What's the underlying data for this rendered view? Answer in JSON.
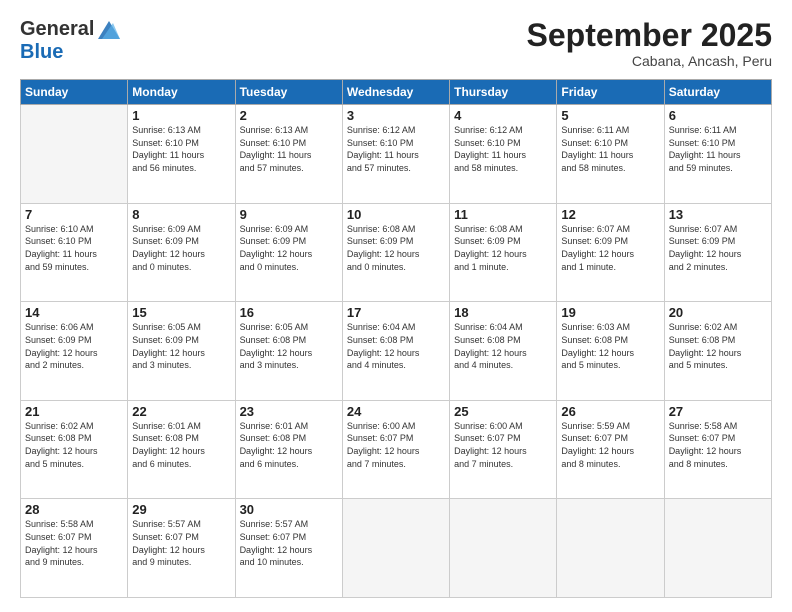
{
  "header": {
    "logo_general": "General",
    "logo_blue": "Blue",
    "month_title": "September 2025",
    "location": "Cabana, Ancash, Peru"
  },
  "weekdays": [
    "Sunday",
    "Monday",
    "Tuesday",
    "Wednesday",
    "Thursday",
    "Friday",
    "Saturday"
  ],
  "weeks": [
    [
      {
        "day": "",
        "info": ""
      },
      {
        "day": "1",
        "info": "Sunrise: 6:13 AM\nSunset: 6:10 PM\nDaylight: 11 hours\nand 56 minutes."
      },
      {
        "day": "2",
        "info": "Sunrise: 6:13 AM\nSunset: 6:10 PM\nDaylight: 11 hours\nand 57 minutes."
      },
      {
        "day": "3",
        "info": "Sunrise: 6:12 AM\nSunset: 6:10 PM\nDaylight: 11 hours\nand 57 minutes."
      },
      {
        "day": "4",
        "info": "Sunrise: 6:12 AM\nSunset: 6:10 PM\nDaylight: 11 hours\nand 58 minutes."
      },
      {
        "day": "5",
        "info": "Sunrise: 6:11 AM\nSunset: 6:10 PM\nDaylight: 11 hours\nand 58 minutes."
      },
      {
        "day": "6",
        "info": "Sunrise: 6:11 AM\nSunset: 6:10 PM\nDaylight: 11 hours\nand 59 minutes."
      }
    ],
    [
      {
        "day": "7",
        "info": "Sunrise: 6:10 AM\nSunset: 6:10 PM\nDaylight: 11 hours\nand 59 minutes."
      },
      {
        "day": "8",
        "info": "Sunrise: 6:09 AM\nSunset: 6:09 PM\nDaylight: 12 hours\nand 0 minutes."
      },
      {
        "day": "9",
        "info": "Sunrise: 6:09 AM\nSunset: 6:09 PM\nDaylight: 12 hours\nand 0 minutes."
      },
      {
        "day": "10",
        "info": "Sunrise: 6:08 AM\nSunset: 6:09 PM\nDaylight: 12 hours\nand 0 minutes."
      },
      {
        "day": "11",
        "info": "Sunrise: 6:08 AM\nSunset: 6:09 PM\nDaylight: 12 hours\nand 1 minute."
      },
      {
        "day": "12",
        "info": "Sunrise: 6:07 AM\nSunset: 6:09 PM\nDaylight: 12 hours\nand 1 minute."
      },
      {
        "day": "13",
        "info": "Sunrise: 6:07 AM\nSunset: 6:09 PM\nDaylight: 12 hours\nand 2 minutes."
      }
    ],
    [
      {
        "day": "14",
        "info": "Sunrise: 6:06 AM\nSunset: 6:09 PM\nDaylight: 12 hours\nand 2 minutes."
      },
      {
        "day": "15",
        "info": "Sunrise: 6:05 AM\nSunset: 6:09 PM\nDaylight: 12 hours\nand 3 minutes."
      },
      {
        "day": "16",
        "info": "Sunrise: 6:05 AM\nSunset: 6:08 PM\nDaylight: 12 hours\nand 3 minutes."
      },
      {
        "day": "17",
        "info": "Sunrise: 6:04 AM\nSunset: 6:08 PM\nDaylight: 12 hours\nand 4 minutes."
      },
      {
        "day": "18",
        "info": "Sunrise: 6:04 AM\nSunset: 6:08 PM\nDaylight: 12 hours\nand 4 minutes."
      },
      {
        "day": "19",
        "info": "Sunrise: 6:03 AM\nSunset: 6:08 PM\nDaylight: 12 hours\nand 5 minutes."
      },
      {
        "day": "20",
        "info": "Sunrise: 6:02 AM\nSunset: 6:08 PM\nDaylight: 12 hours\nand 5 minutes."
      }
    ],
    [
      {
        "day": "21",
        "info": "Sunrise: 6:02 AM\nSunset: 6:08 PM\nDaylight: 12 hours\nand 5 minutes."
      },
      {
        "day": "22",
        "info": "Sunrise: 6:01 AM\nSunset: 6:08 PM\nDaylight: 12 hours\nand 6 minutes."
      },
      {
        "day": "23",
        "info": "Sunrise: 6:01 AM\nSunset: 6:08 PM\nDaylight: 12 hours\nand 6 minutes."
      },
      {
        "day": "24",
        "info": "Sunrise: 6:00 AM\nSunset: 6:07 PM\nDaylight: 12 hours\nand 7 minutes."
      },
      {
        "day": "25",
        "info": "Sunrise: 6:00 AM\nSunset: 6:07 PM\nDaylight: 12 hours\nand 7 minutes."
      },
      {
        "day": "26",
        "info": "Sunrise: 5:59 AM\nSunset: 6:07 PM\nDaylight: 12 hours\nand 8 minutes."
      },
      {
        "day": "27",
        "info": "Sunrise: 5:58 AM\nSunset: 6:07 PM\nDaylight: 12 hours\nand 8 minutes."
      }
    ],
    [
      {
        "day": "28",
        "info": "Sunrise: 5:58 AM\nSunset: 6:07 PM\nDaylight: 12 hours\nand 9 minutes."
      },
      {
        "day": "29",
        "info": "Sunrise: 5:57 AM\nSunset: 6:07 PM\nDaylight: 12 hours\nand 9 minutes."
      },
      {
        "day": "30",
        "info": "Sunrise: 5:57 AM\nSunset: 6:07 PM\nDaylight: 12 hours\nand 10 minutes."
      },
      {
        "day": "",
        "info": ""
      },
      {
        "day": "",
        "info": ""
      },
      {
        "day": "",
        "info": ""
      },
      {
        "day": "",
        "info": ""
      }
    ]
  ]
}
